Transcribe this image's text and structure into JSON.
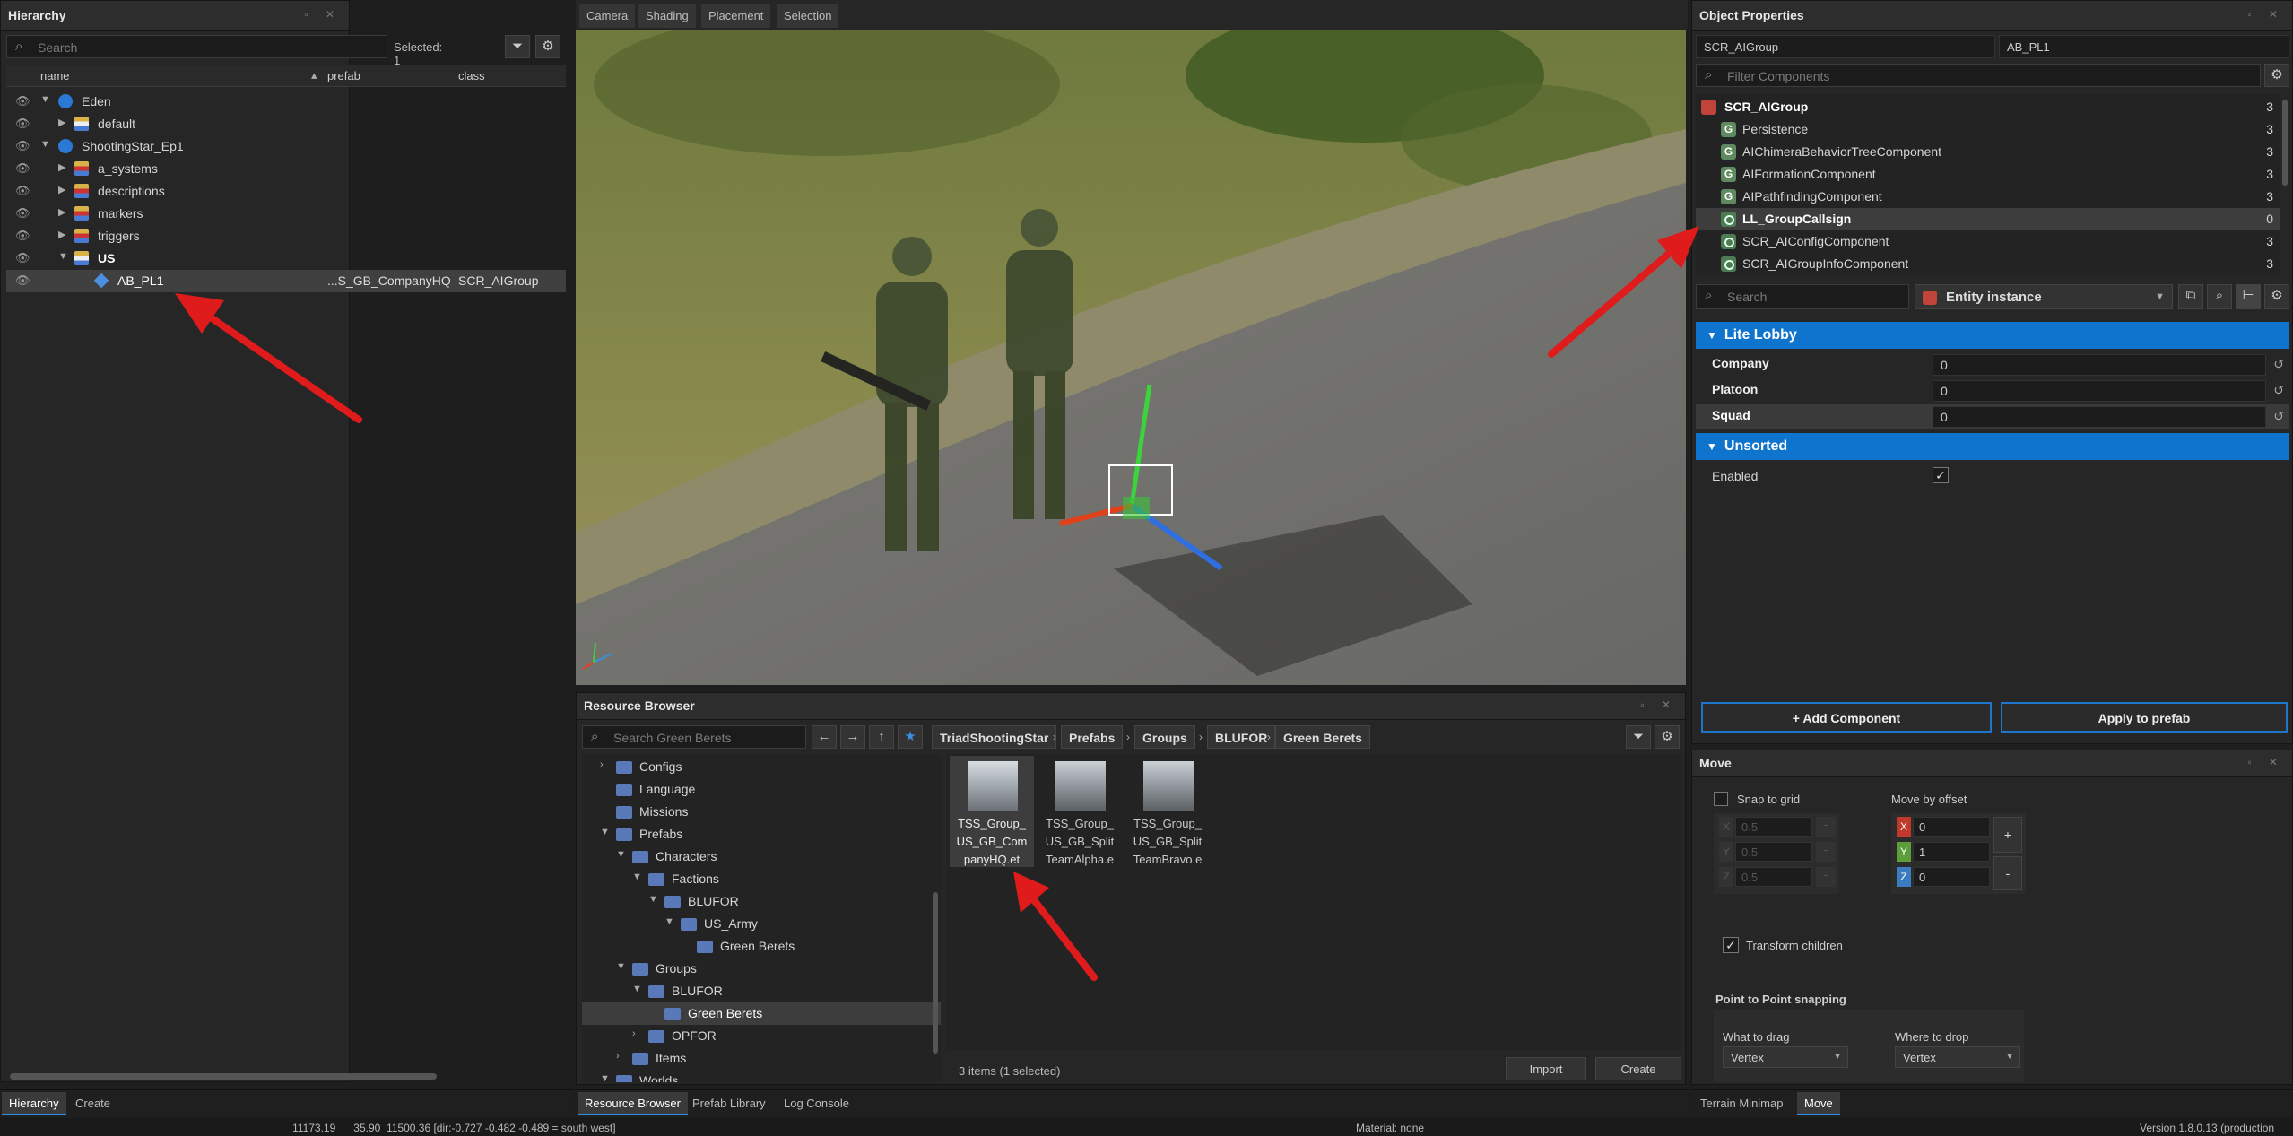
{
  "hierarchy": {
    "title": "Hierarchy",
    "search_placeholder": "Search",
    "selected": "Selected: 1",
    "columns": [
      "name",
      "prefab",
      "class"
    ],
    "items": [
      {
        "label": "Eden"
      },
      {
        "label": "default"
      },
      {
        "label": "ShootingStar_Ep1"
      },
      {
        "label": "a_systems"
      },
      {
        "label": "descriptions"
      },
      {
        "label": "markers"
      },
      {
        "label": "triggers"
      },
      {
        "label": "US"
      },
      {
        "label": "AB_PL1",
        "prefab": "...S_GB_CompanyHQ",
        "class": "SCR_AIGroup"
      }
    ],
    "tabs": [
      "Hierarchy",
      "Create"
    ]
  },
  "viewport": {
    "tabs": [
      "Camera",
      "Shading",
      "Placement",
      "Selection"
    ]
  },
  "resource_browser": {
    "title": "Resource Browser",
    "search_placeholder": "Search Green Berets",
    "breadcrumb": [
      "TriadShootingStar",
      "Prefabs",
      "Groups",
      "BLUFOR",
      "Green Berets"
    ],
    "tree": [
      {
        "label": "Configs"
      },
      {
        "label": "Language"
      },
      {
        "label": "Missions"
      },
      {
        "label": "Prefabs"
      },
      {
        "label": "Characters"
      },
      {
        "label": "Factions"
      },
      {
        "label": "BLUFOR"
      },
      {
        "label": "US_Army"
      },
      {
        "label": "Green Berets"
      },
      {
        "label": "Groups"
      },
      {
        "label": "BLUFOR"
      },
      {
        "label": "Green Berets"
      },
      {
        "label": "OPFOR"
      },
      {
        "label": "Items"
      },
      {
        "label": "Worlds"
      }
    ],
    "files": [
      {
        "name": "TSS_Group_ US_GB_Com panyHQ.et"
      },
      {
        "name": "TSS_Group_ US_GB_Split TeamAlpha.e"
      },
      {
        "name": "TSS_Group_ US_GB_Split TeamBravo.e"
      }
    ],
    "status": "3 items (1 selected)",
    "import_label": "Import",
    "create_label": "Create",
    "tabs": [
      "Resource Browser",
      "Prefab Library",
      "Log Console"
    ]
  },
  "object_properties": {
    "title": "Object Properties",
    "class_field": "SCR_AIGroup",
    "name_field": "AB_PL1",
    "filter_placeholder": "Filter Components",
    "root": {
      "label": "SCR_AIGroup",
      "count": "3"
    },
    "components": [
      {
        "label": "Persistence",
        "count": "3",
        "icon": "g"
      },
      {
        "label": "AIChimeraBehaviorTreeComponent",
        "count": "3",
        "icon": "g"
      },
      {
        "label": "AIFormationComponent",
        "count": "3",
        "icon": "g"
      },
      {
        "label": "AIPathfindingComponent",
        "count": "3",
        "icon": "g"
      },
      {
        "label": "LL_GroupCallsign",
        "count": "0",
        "icon": "ring"
      },
      {
        "label": "SCR_AIConfigComponent",
        "count": "3",
        "icon": "ring"
      },
      {
        "label": "SCR_AIGroupInfoComponent",
        "count": "3",
        "icon": "ring"
      }
    ],
    "search_placeholder": "Search",
    "instance_label": "Entity instance",
    "sections": [
      {
        "title": "Lite Lobby",
        "props": [
          {
            "label": "Company",
            "value": "0"
          },
          {
            "label": "Platoon",
            "value": "0"
          },
          {
            "label": "Squad",
            "value": "0"
          }
        ]
      },
      {
        "title": "Unsorted",
        "props": [
          {
            "label": "Enabled",
            "checked": true
          }
        ]
      }
    ],
    "add_component_label": "+ Add Component",
    "apply_prefab_label": "Apply to prefab"
  },
  "move": {
    "title": "Move",
    "snap_label": "Snap to grid",
    "snap_values": [
      "0.5",
      "0.5",
      "0.5"
    ],
    "offset_label": "Move by offset",
    "offset_values": {
      "x": "0",
      "y": "1",
      "z": "0"
    },
    "transform_children_label": "Transform children",
    "p2p_label": "Point to Point snapping",
    "drag_label": "What to drag",
    "drag_value": "Vertex",
    "drop_label": "Where to drop",
    "drop_value": "Vertex",
    "tabs": [
      "Terrain Minimap",
      "Move"
    ]
  },
  "status_bar": {
    "coords": "11173.19      35.90  11500.36 [dir:-0.727 -0.482 -0.489 = south west]",
    "material": "Material: none",
    "version": "Version 1.8.0.13 (production"
  },
  "colors": {
    "accent": "#0f74cd",
    "annotation_arrow": "#e01b1b"
  }
}
